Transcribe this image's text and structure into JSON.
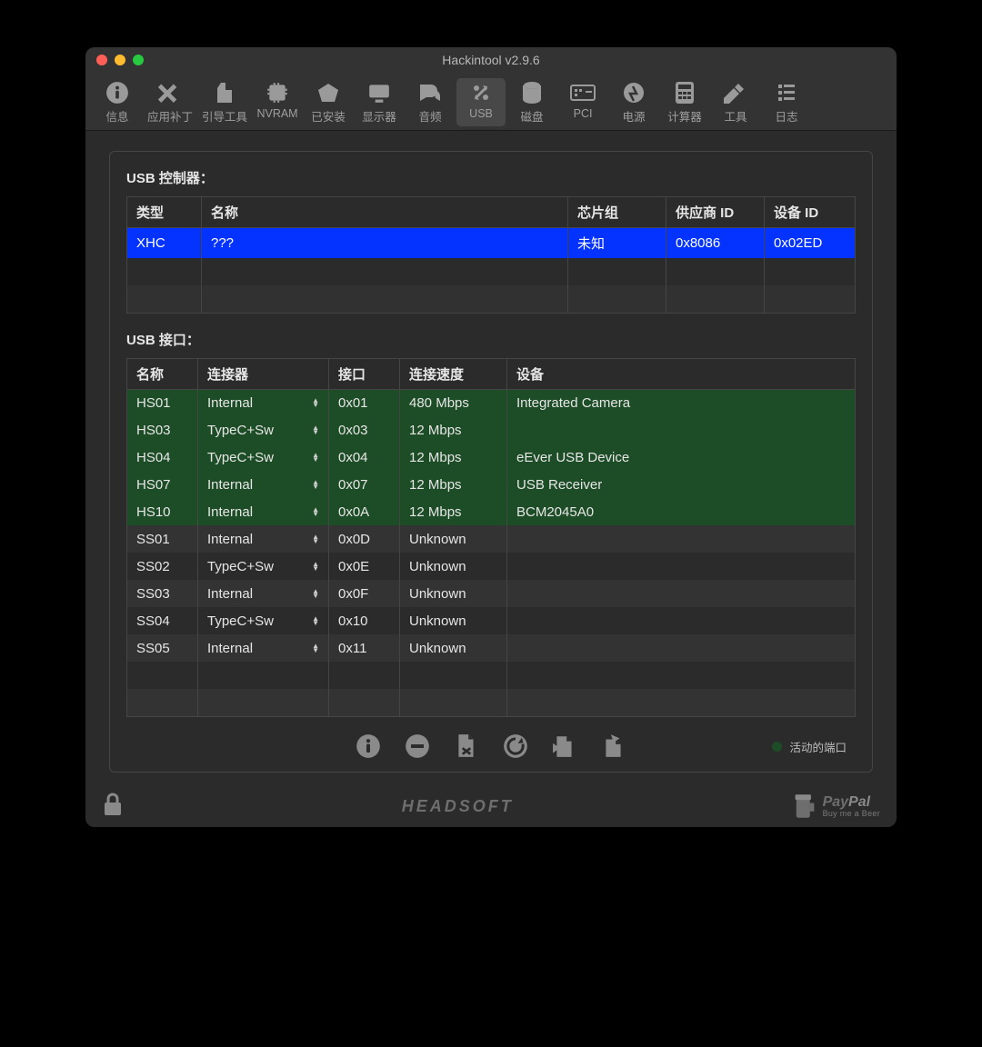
{
  "window": {
    "title": "Hackintool v2.9.6"
  },
  "toolbar": {
    "items": [
      {
        "label": "信息"
      },
      {
        "label": "应用补丁"
      },
      {
        "label": "引导工具"
      },
      {
        "label": "NVRAM"
      },
      {
        "label": "已安装"
      },
      {
        "label": "显示器"
      },
      {
        "label": "音频"
      },
      {
        "label": "USB"
      },
      {
        "label": "磁盘"
      },
      {
        "label": "PCI"
      },
      {
        "label": "电源"
      },
      {
        "label": "计算器"
      },
      {
        "label": "工具"
      },
      {
        "label": "日志"
      }
    ],
    "active_index": 7
  },
  "section_controllers": {
    "title": "USB 控制器：",
    "headers": {
      "type": "类型",
      "name": "名称",
      "chipset": "芯片组",
      "vendor_id": "供应商 ID",
      "device_id": "设备 ID"
    },
    "rows": [
      {
        "type": "XHC",
        "name": "???",
        "chipset": "未知",
        "vendor_id": "0x8086",
        "device_id": "0x02ED",
        "selected": true
      }
    ]
  },
  "section_ports": {
    "title": "USB 接口：",
    "headers": {
      "name": "名称",
      "connector": "连接器",
      "port": "接口",
      "speed": "连接速度",
      "device": "设备"
    },
    "rows": [
      {
        "name": "HS01",
        "connector": "Internal",
        "port": "0x01",
        "speed": "480 Mbps",
        "device": "Integrated Camera",
        "active": true
      },
      {
        "name": "HS03",
        "connector": "TypeC+Sw",
        "port": "0x03",
        "speed": "12 Mbps",
        "device": "",
        "active": true
      },
      {
        "name": "HS04",
        "connector": "TypeC+Sw",
        "port": "0x04",
        "speed": "12 Mbps",
        "device": "eEver USB Device",
        "active": true
      },
      {
        "name": "HS07",
        "connector": "Internal",
        "port": "0x07",
        "speed": "12 Mbps",
        "device": "USB Receiver",
        "active": true
      },
      {
        "name": "HS10",
        "connector": "Internal",
        "port": "0x0A",
        "speed": "12 Mbps",
        "device": "BCM2045A0",
        "active": true
      },
      {
        "name": "SS01",
        "connector": "Internal",
        "port": "0x0D",
        "speed": "Unknown",
        "device": "",
        "active": false
      },
      {
        "name": "SS02",
        "connector": "TypeC+Sw",
        "port": "0x0E",
        "speed": "Unknown",
        "device": "",
        "active": false
      },
      {
        "name": "SS03",
        "connector": "Internal",
        "port": "0x0F",
        "speed": "Unknown",
        "device": "",
        "active": false
      },
      {
        "name": "SS04",
        "connector": "TypeC+Sw",
        "port": "0x10",
        "speed": "Unknown",
        "device": "",
        "active": false
      },
      {
        "name": "SS05",
        "connector": "Internal",
        "port": "0x11",
        "speed": "Unknown",
        "device": "",
        "active": false
      }
    ]
  },
  "legend": {
    "label": "活动的端口"
  },
  "footer": {
    "brand": "HEADSOFT",
    "paypal_main_a": "Pay",
    "paypal_main_b": "Pal",
    "paypal_sub": "Buy me a Beer"
  }
}
